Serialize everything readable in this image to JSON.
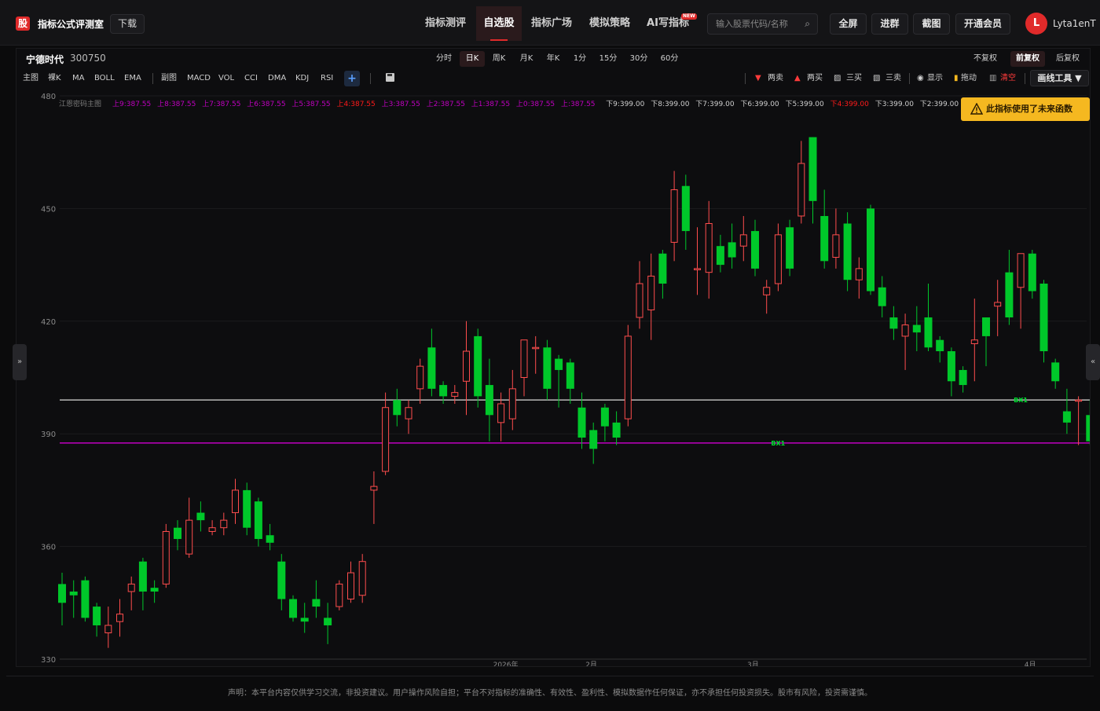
{
  "header": {
    "logo_char": "股",
    "brand": "指标公式评测室",
    "download": "下载",
    "nav": [
      "指标测评",
      "自选股",
      "指标广场",
      "模拟策略",
      "AI写指标"
    ],
    "new_badge": "NEW",
    "search_placeholder": "输入股票代码/名称",
    "buttons": [
      "全屏",
      "进群",
      "截图",
      "开通会员"
    ],
    "avatar_initial": "L",
    "username": "Lyta1enT"
  },
  "stock": {
    "name": "宁德时代",
    "code": "300750"
  },
  "periods": [
    "分时",
    "日K",
    "周K",
    "月K",
    "年K",
    "1分",
    "15分",
    "30分",
    "60分"
  ],
  "adjust": [
    "不复权",
    "前复权",
    "后复权"
  ],
  "indicators_main": [
    "主图",
    "裸K",
    "MA",
    "BOLL",
    "EMA"
  ],
  "indicators_sub": [
    "副图",
    "MACD",
    "VOL",
    "CCI",
    "DMA",
    "KDJ",
    "RSI"
  ],
  "plus_label": "+",
  "draw_bar": {
    "sell2": "两卖",
    "buy2": "两买",
    "buy3": "三买",
    "sell3": "三卖",
    "show": "显示",
    "drag": "拖动",
    "clear": "清空",
    "tools": "画线工具 ▼"
  },
  "warning": "此指标使用了未来函数",
  "side_left": "»",
  "side_right": "«",
  "footer": "声明：本平台内容仅供学习交流，非投资建议。用户操作风险自担；平台不对指标的准确性、有效性、盈利性、模拟数据作任何保证，亦不承担任何投资损失。股市有风险，投资需谨慎。",
  "colors": {
    "up": "#ff4d4d",
    "down": "#00c82a",
    "accent": "#e02a2a",
    "line_upper": "#b8b8b8",
    "line_lower": "#c000c0",
    "warn": "#f5b820"
  },
  "chart_data": {
    "type": "candlestick",
    "title": "江恩密码主图",
    "legend": [
      {
        "label": "上9:387.55",
        "color": "#c000c0"
      },
      {
        "label": "上8:387.55",
        "color": "#c000c0"
      },
      {
        "label": "上7:387.55",
        "color": "#c000c0"
      },
      {
        "label": "上6:387.55",
        "color": "#c000c0"
      },
      {
        "label": "上5:387.55",
        "color": "#c000c0"
      },
      {
        "label": "上4:387.55",
        "color": "#ff1a1a"
      },
      {
        "label": "上3:387.55",
        "color": "#c000c0"
      },
      {
        "label": "上2:387.55",
        "color": "#c000c0"
      },
      {
        "label": "上1:387.55",
        "color": "#c000c0"
      },
      {
        "label": "上0:387.55",
        "color": "#c000c0"
      },
      {
        "label": "上:387.55",
        "color": "#c000c0"
      },
      {
        "label": "下9:399.00",
        "color": "#cfcfcf"
      },
      {
        "label": "下8:399.00",
        "color": "#cfcfcf"
      },
      {
        "label": "下7:399.00",
        "color": "#cfcfcf"
      },
      {
        "label": "下6:399.00",
        "color": "#cfcfcf"
      },
      {
        "label": "下5:399.00",
        "color": "#cfcfcf"
      },
      {
        "label": "下4:399.00",
        "color": "#ff1a1a"
      },
      {
        "label": "下3:399.00",
        "color": "#cfcfcf"
      },
      {
        "label": "下2:399.00",
        "color": "#cfcfcf"
      }
    ],
    "y_ticks": [
      480,
      450,
      420,
      390,
      360,
      330
    ],
    "ylim": [
      330,
      480
    ],
    "x_ticks": [
      {
        "label": "2026年",
        "index": 38
      },
      {
        "label": "2月",
        "index": 46
      },
      {
        "label": "3月",
        "index": 60
      },
      {
        "label": "4月",
        "index": 84
      }
    ],
    "hlines": [
      {
        "value": 399.0,
        "color": "#b8b8b8",
        "label": "BX1",
        "label_index": 83
      },
      {
        "value": 387.55,
        "color": "#c000c0",
        "label": "BX1",
        "label_index": 62
      }
    ],
    "candles": [
      {
        "o": 350,
        "h": 353,
        "l": 339,
        "c": 345
      },
      {
        "o": 348,
        "h": 351,
        "l": 341,
        "c": 347
      },
      {
        "o": 351,
        "h": 352,
        "l": 340,
        "c": 341
      },
      {
        "o": 344,
        "h": 345,
        "l": 336,
        "c": 339
      },
      {
        "o": 337,
        "h": 344,
        "l": 333,
        "c": 339
      },
      {
        "o": 340,
        "h": 346,
        "l": 336,
        "c": 342
      },
      {
        "o": 348,
        "h": 352,
        "l": 343,
        "c": 350
      },
      {
        "o": 356,
        "h": 357,
        "l": 343,
        "c": 348
      },
      {
        "o": 349,
        "h": 351,
        "l": 345,
        "c": 348
      },
      {
        "o": 350,
        "h": 366,
        "l": 349,
        "c": 364
      },
      {
        "o": 365,
        "h": 367,
        "l": 359,
        "c": 362
      },
      {
        "o": 358,
        "h": 373,
        "l": 357,
        "c": 367
      },
      {
        "o": 369,
        "h": 372,
        "l": 364,
        "c": 367
      },
      {
        "o": 364,
        "h": 367,
        "l": 363,
        "c": 365
      },
      {
        "o": 365,
        "h": 369,
        "l": 363,
        "c": 367
      },
      {
        "o": 369,
        "h": 378,
        "l": 366,
        "c": 375
      },
      {
        "o": 375,
        "h": 377,
        "l": 363,
        "c": 365
      },
      {
        "o": 372,
        "h": 373,
        "l": 360,
        "c": 362
      },
      {
        "o": 363,
        "h": 366,
        "l": 359,
        "c": 361
      },
      {
        "o": 356,
        "h": 358,
        "l": 343,
        "c": 346
      },
      {
        "o": 346,
        "h": 347,
        "l": 340,
        "c": 341
      },
      {
        "o": 341,
        "h": 345,
        "l": 337,
        "c": 340
      },
      {
        "o": 346,
        "h": 351,
        "l": 341,
        "c": 344
      },
      {
        "o": 341,
        "h": 345,
        "l": 334,
        "c": 339
      },
      {
        "o": 344,
        "h": 351,
        "l": 343,
        "c": 350
      },
      {
        "o": 346,
        "h": 356,
        "l": 345,
        "c": 353
      },
      {
        "o": 347,
        "h": 358,
        "l": 345,
        "c": 356
      },
      {
        "o": 375,
        "h": 380,
        "l": 366,
        "c": 376
      },
      {
        "o": 380,
        "h": 401,
        "l": 379,
        "c": 397
      },
      {
        "o": 399,
        "h": 402,
        "l": 392,
        "c": 395
      },
      {
        "o": 394,
        "h": 399,
        "l": 390,
        "c": 397
      },
      {
        "o": 402,
        "h": 410,
        "l": 398,
        "c": 408
      },
      {
        "o": 413,
        "h": 418,
        "l": 400,
        "c": 402
      },
      {
        "o": 403,
        "h": 404,
        "l": 398,
        "c": 400
      },
      {
        "o": 400,
        "h": 403,
        "l": 398,
        "c": 401
      },
      {
        "o": 404,
        "h": 420,
        "l": 395,
        "c": 412
      },
      {
        "o": 416,
        "h": 418,
        "l": 397,
        "c": 400
      },
      {
        "o": 403,
        "h": 410,
        "l": 388,
        "c": 395
      },
      {
        "o": 393,
        "h": 401,
        "l": 388,
        "c": 398
      },
      {
        "o": 394,
        "h": 407,
        "l": 391,
        "c": 402
      },
      {
        "o": 405,
        "h": 415,
        "l": 400,
        "c": 415
      },
      {
        "o": 413,
        "h": 416,
        "l": 406,
        "c": 413
      },
      {
        "o": 413,
        "h": 415,
        "l": 399,
        "c": 402
      },
      {
        "o": 410,
        "h": 411,
        "l": 397,
        "c": 407
      },
      {
        "o": 409,
        "h": 410,
        "l": 398,
        "c": 402
      },
      {
        "o": 397,
        "h": 401,
        "l": 386,
        "c": 389
      },
      {
        "o": 391,
        "h": 393,
        "l": 382,
        "c": 386
      },
      {
        "o": 397,
        "h": 398,
        "l": 388,
        "c": 392
      },
      {
        "o": 393,
        "h": 396,
        "l": 387,
        "c": 389
      },
      {
        "o": 394,
        "h": 419,
        "l": 392,
        "c": 416
      },
      {
        "o": 421,
        "h": 436,
        "l": 418,
        "c": 430
      },
      {
        "o": 423,
        "h": 438,
        "l": 415,
        "c": 432
      },
      {
        "o": 438,
        "h": 439,
        "l": 426,
        "c": 430
      },
      {
        "o": 441,
        "h": 460,
        "l": 436,
        "c": 455
      },
      {
        "o": 456,
        "h": 459,
        "l": 439,
        "c": 444
      },
      {
        "o": 434,
        "h": 445,
        "l": 427,
        "c": 434
      },
      {
        "o": 433,
        "h": 452,
        "l": 426,
        "c": 446
      },
      {
        "o": 440,
        "h": 443,
        "l": 433,
        "c": 435
      },
      {
        "o": 441,
        "h": 446,
        "l": 434,
        "c": 437
      },
      {
        "o": 440,
        "h": 448,
        "l": 436,
        "c": 443
      },
      {
        "o": 444,
        "h": 447,
        "l": 432,
        "c": 434
      },
      {
        "o": 427,
        "h": 431,
        "l": 422,
        "c": 429
      },
      {
        "o": 430,
        "h": 446,
        "l": 428,
        "c": 443
      },
      {
        "o": 445,
        "h": 447,
        "l": 432,
        "c": 434
      },
      {
        "o": 448,
        "h": 468,
        "l": 446,
        "c": 462
      },
      {
        "o": 469,
        "h": 469,
        "l": 446,
        "c": 452
      },
      {
        "o": 448,
        "h": 455,
        "l": 434,
        "c": 436
      },
      {
        "o": 437,
        "h": 450,
        "l": 434,
        "c": 443
      },
      {
        "o": 446,
        "h": 449,
        "l": 428,
        "c": 431
      },
      {
        "o": 431,
        "h": 437,
        "l": 426,
        "c": 434
      },
      {
        "o": 450,
        "h": 451,
        "l": 427,
        "c": 428
      },
      {
        "o": 429,
        "h": 432,
        "l": 421,
        "c": 424
      },
      {
        "o": 421,
        "h": 424,
        "l": 415,
        "c": 418
      },
      {
        "o": 416,
        "h": 422,
        "l": 407,
        "c": 419
      },
      {
        "o": 419,
        "h": 424,
        "l": 412,
        "c": 417
      },
      {
        "o": 421,
        "h": 430,
        "l": 412,
        "c": 413
      },
      {
        "o": 415,
        "h": 416,
        "l": 409,
        "c": 412
      },
      {
        "o": 412,
        "h": 413,
        "l": 400,
        "c": 404
      },
      {
        "o": 407,
        "h": 408,
        "l": 401,
        "c": 403
      },
      {
        "o": 414,
        "h": 426,
        "l": 404,
        "c": 415
      },
      {
        "o": 421,
        "h": 421,
        "l": 408,
        "c": 416
      },
      {
        "o": 424,
        "h": 431,
        "l": 416,
        "c": 425
      },
      {
        "o": 433,
        "h": 439,
        "l": 419,
        "c": 421
      },
      {
        "o": 429,
        "h": 438,
        "l": 418,
        "c": 438
      },
      {
        "o": 438,
        "h": 439,
        "l": 426,
        "c": 428
      },
      {
        "o": 430,
        "h": 431,
        "l": 409,
        "c": 412
      },
      {
        "o": 409,
        "h": 410,
        "l": 402,
        "c": 404
      },
      {
        "o": 396,
        "h": 402,
        "l": 390,
        "c": 393
      },
      {
        "o": 399,
        "h": 400,
        "l": 387,
        "c": 399
      },
      {
        "o": 395,
        "h": 399,
        "l": 387,
        "c": 388
      }
    ]
  }
}
